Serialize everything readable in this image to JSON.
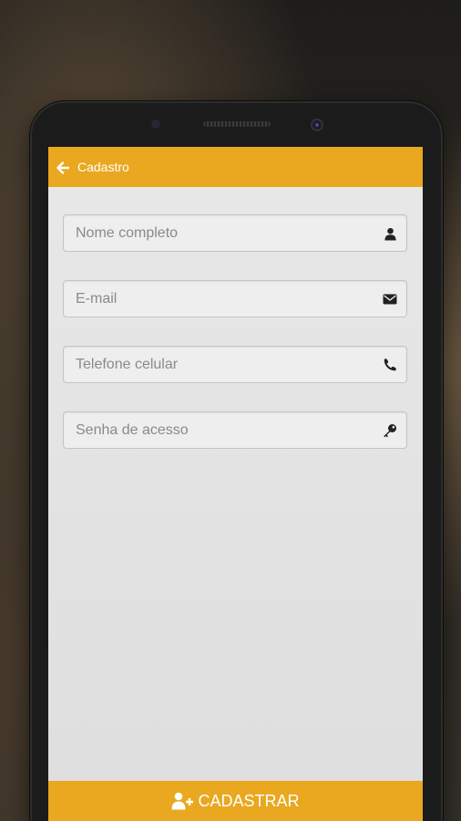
{
  "header": {
    "title": "Cadastro",
    "back_icon": "arrow-left-icon"
  },
  "form": {
    "fields": [
      {
        "placeholder": "Nome completo",
        "value": "",
        "icon": "user-icon"
      },
      {
        "placeholder": "E-mail",
        "value": "",
        "icon": "envelope-icon"
      },
      {
        "placeholder": "Telefone celular",
        "value": "",
        "icon": "phone-icon"
      },
      {
        "placeholder": "Senha de acesso",
        "value": "",
        "icon": "key-icon"
      }
    ]
  },
  "footer": {
    "submit_label": "CADASTRAR",
    "submit_icon": "user-plus-icon"
  },
  "colors": {
    "accent": "#e9a820",
    "screen_bg": "#e4e4e4"
  }
}
